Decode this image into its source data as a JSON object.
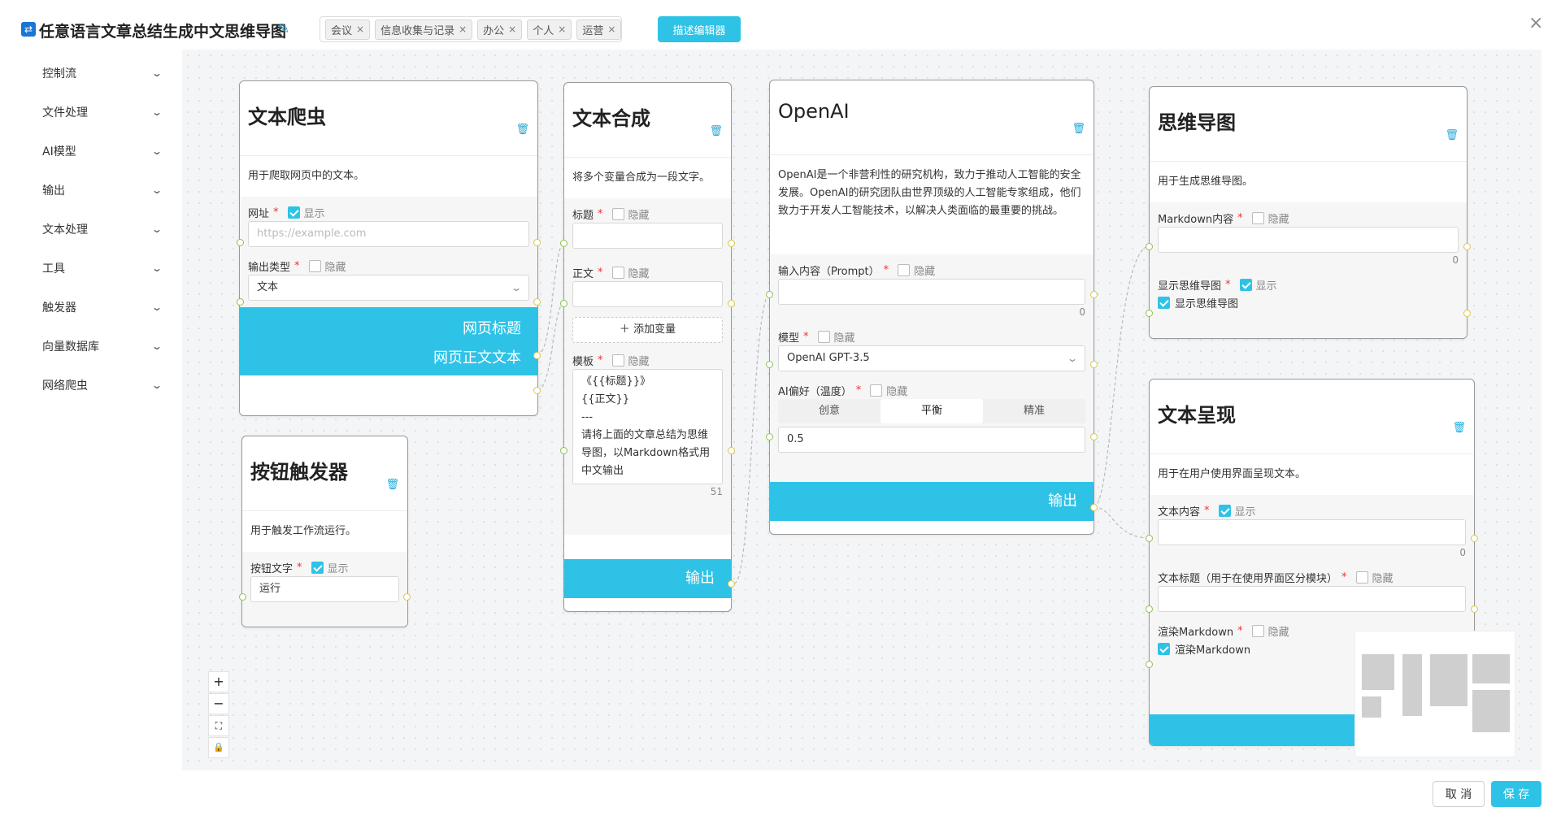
{
  "header": {
    "title": "任意语言文章总结生成中文思维导图",
    "tags": [
      "会议",
      "信息收集与记录",
      "办公",
      "个人",
      "运营"
    ],
    "describe_editor_label": "描述编辑器",
    "close_glyph": "×"
  },
  "sidebar": {
    "items": [
      {
        "label": "控制流"
      },
      {
        "label": "文件处理"
      },
      {
        "label": "AI模型"
      },
      {
        "label": "输出"
      },
      {
        "label": "文本处理"
      },
      {
        "label": "工具"
      },
      {
        "label": "触发器"
      },
      {
        "label": "向量数据库"
      },
      {
        "label": "网络爬虫"
      }
    ]
  },
  "common": {
    "show": "显示",
    "hide": "隐藏",
    "required": "*",
    "output": "输出"
  },
  "nodes": {
    "crawler": {
      "title": "文本爬虫",
      "desc": "用于爬取网页中的文本。",
      "url_label": "网址",
      "url_placeholder": "https://example.com",
      "output_type_label": "输出类型",
      "output_type_value": "文本",
      "out_title": "网页标题",
      "out_text": "网页正文文本"
    },
    "button_trigger": {
      "title": "按钮触发器",
      "desc": "用于触发工作流运行。",
      "button_text_label": "按钮文字",
      "button_text_value": "运行"
    },
    "text_combine": {
      "title": "文本合成",
      "desc": "将多个变量合成为一段文字。",
      "var1_label": "标题",
      "var2_label": "正文",
      "add_var": "添加变量",
      "template_label": "模板",
      "template_value": "《{{标题}}》\n{{正文}}\n---\n请将上面的文章总结为思维导图，以Markdown格式用中文输出",
      "template_count": "51"
    },
    "openai": {
      "title": "OpenAI",
      "desc": "OpenAI是一个非营利性的研究机构，致力于推动人工智能的安全发展。OpenAI的研究团队由世界顶级的人工智能专家组成，他们致力于开发人工智能技术，以解决人类面临的最重要的挑战。",
      "prompt_label": "输入内容（Prompt）",
      "prompt_count": "0",
      "model_label": "模型",
      "model_value": "OpenAI GPT-3.5",
      "temp_label": "AI偏好（温度）",
      "temp_options": [
        "创意",
        "平衡",
        "精准"
      ],
      "temp_value": "0.5"
    },
    "mindmap": {
      "title": "思维导图",
      "desc": "用于生成思维导图。",
      "md_label": "Markdown内容",
      "md_count": "0",
      "show_label": "显示思维导图",
      "show_check_label": "显示思维导图"
    },
    "text_display": {
      "title": "文本呈现",
      "desc": "用于在用户使用界面呈现文本。",
      "content_label": "文本内容",
      "content_count": "0",
      "title_label": "文本标题（用于在使用界面区分模块）",
      "render_label": "渲染Markdown",
      "render_check_label": "渲染Markdown"
    }
  },
  "zoom_controls": [
    "+",
    "−",
    "⛶",
    "🔒"
  ],
  "footer": {
    "cancel": "取 消",
    "save": "保 存"
  },
  "colors": {
    "accent": "#2ec3e6",
    "port_green": "#8bc34a",
    "port_yellow": "#d6c94a"
  }
}
